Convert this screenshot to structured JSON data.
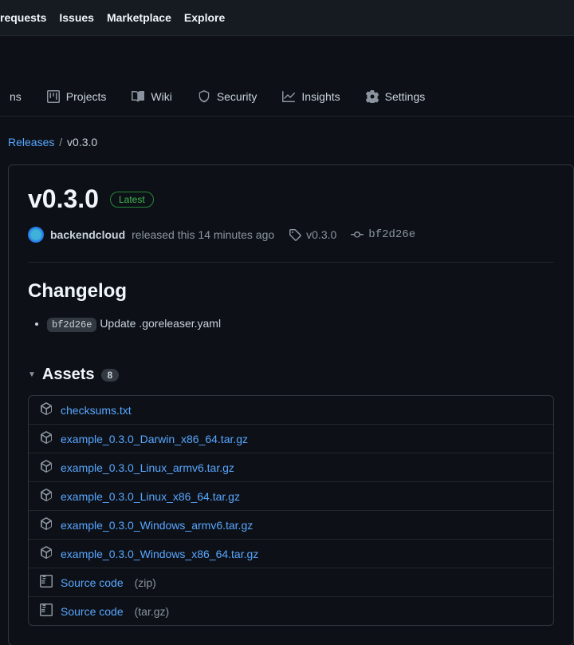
{
  "topnav": {
    "items": [
      "requests",
      "Issues",
      "Marketplace",
      "Explore"
    ]
  },
  "tabs": [
    {
      "label": "ns",
      "icon": "play"
    },
    {
      "label": "Projects",
      "icon": "project"
    },
    {
      "label": "Wiki",
      "icon": "book"
    },
    {
      "label": "Security",
      "icon": "shield"
    },
    {
      "label": "Insights",
      "icon": "graph"
    },
    {
      "label": "Settings",
      "icon": "gear"
    }
  ],
  "breadcrumb": {
    "parent": "Releases",
    "current": "v0.3.0"
  },
  "release": {
    "title": "v0.3.0",
    "badge": "Latest",
    "author": "backendcloud",
    "released_text": "released this 14 minutes ago",
    "tag": "v0.3.0",
    "commit_sha": "bf2d26e"
  },
  "changelog": {
    "heading": "Changelog",
    "items": [
      {
        "sha": "bf2d26e",
        "msg": "Update .goreleaser.yaml"
      }
    ]
  },
  "assets": {
    "heading": "Assets",
    "count": "8",
    "files": [
      {
        "name": "checksums.txt",
        "icon": "package"
      },
      {
        "name": "example_0.3.0_Darwin_x86_64.tar.gz",
        "icon": "package"
      },
      {
        "name": "example_0.3.0_Linux_armv6.tar.gz",
        "icon": "package"
      },
      {
        "name": "example_0.3.0_Linux_x86_64.tar.gz",
        "icon": "package"
      },
      {
        "name": "example_0.3.0_Windows_armv6.tar.gz",
        "icon": "package"
      },
      {
        "name": "example_0.3.0_Windows_x86_64.tar.gz",
        "icon": "package"
      },
      {
        "name": "Source code",
        "suffix": "(zip)",
        "icon": "zip"
      },
      {
        "name": "Source code",
        "suffix": "(tar.gz)",
        "icon": "zip"
      }
    ]
  }
}
